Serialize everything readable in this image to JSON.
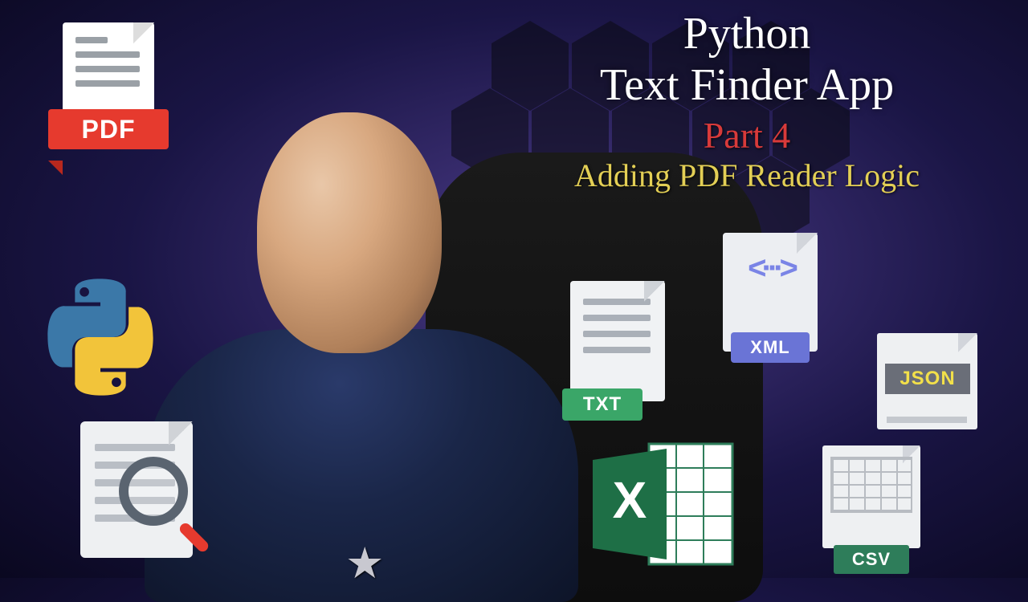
{
  "title": {
    "line1": "Python",
    "line2": "Text Finder App",
    "part": "Part 4",
    "subtitle": "Adding PDF Reader Logic"
  },
  "icons": {
    "pdf": "PDF",
    "txt": "TXT",
    "xml": "XML",
    "xml_code": "<···>",
    "json": "JSON",
    "csv": "CSV"
  }
}
